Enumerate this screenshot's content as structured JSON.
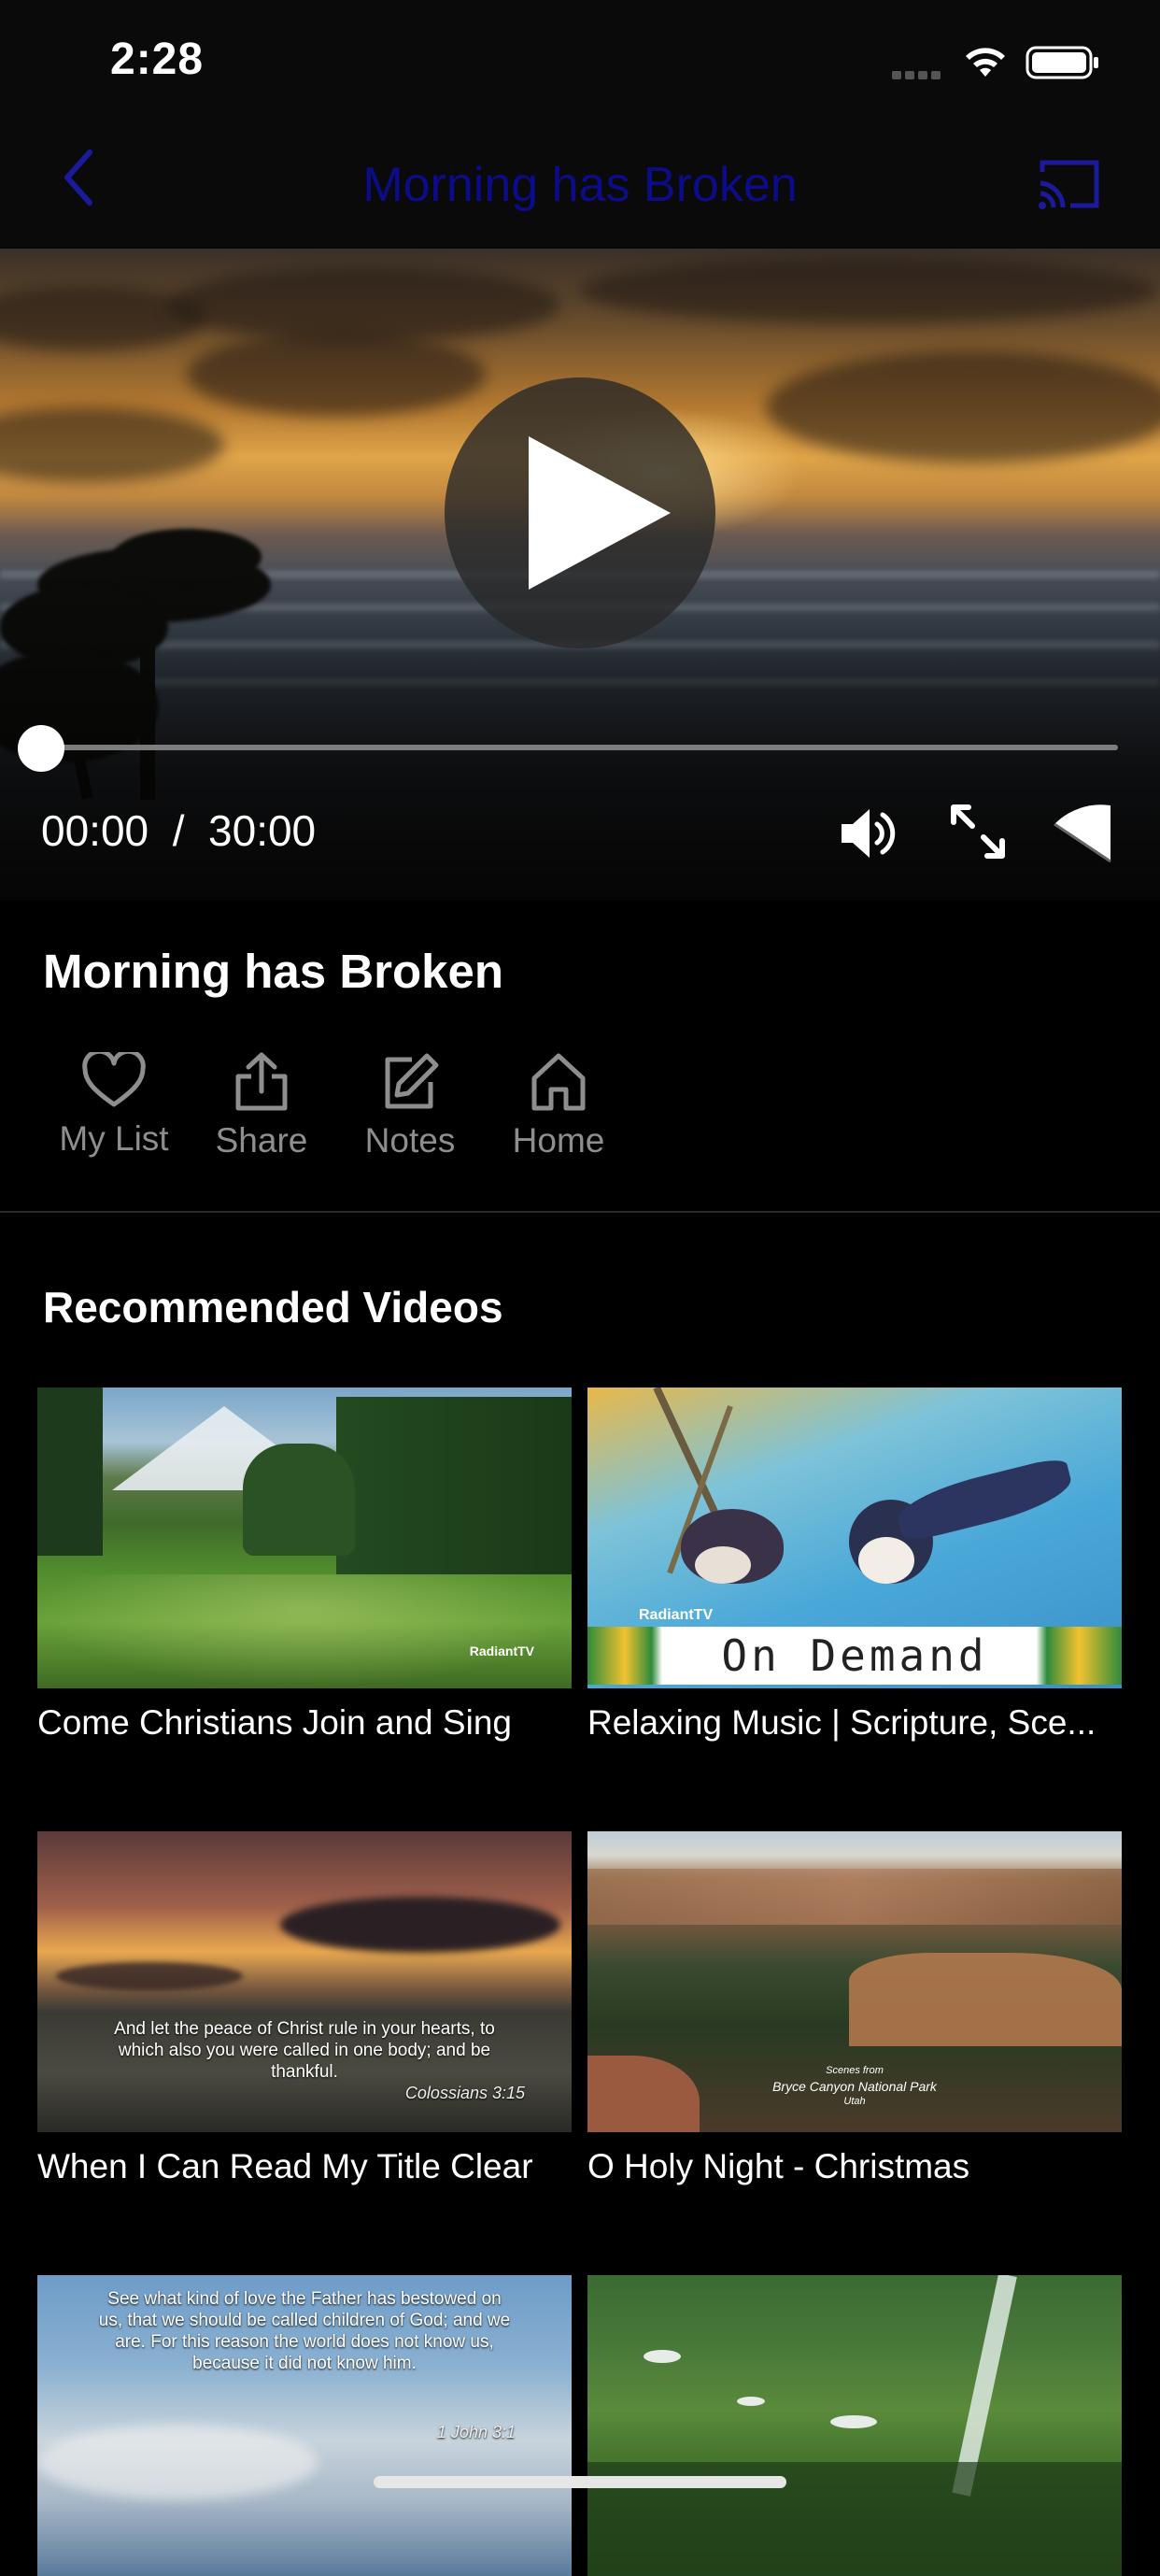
{
  "status_bar": {
    "time": "2:28"
  },
  "nav": {
    "title": "Morning has Broken"
  },
  "player": {
    "elapsed": "00:00",
    "separator": "/",
    "duration": "30:00",
    "progress_fraction": 0.0
  },
  "video": {
    "title": "Morning has Broken"
  },
  "actions": [
    {
      "label": "My List",
      "icon": "heart-icon"
    },
    {
      "label": "Share",
      "icon": "share-icon"
    },
    {
      "label": "Notes",
      "icon": "edit-icon"
    },
    {
      "label": "Home",
      "icon": "home-icon"
    }
  ],
  "recommended": {
    "title": "Recommended Videos",
    "items": [
      {
        "label": "Come Christians Join and Sing",
        "watermark": "RadiantTV"
      },
      {
        "label": "Relaxing Music | Scripture, Sce...",
        "watermark": "RadiantTV",
        "banner": "On Demand"
      },
      {
        "label": "When I Can Read My Title Clear",
        "verse": "And let the peace of Christ rule in your hearts, to which also you were called in one body; and be thankful.",
        "verse_ref": "Colossians 3:15"
      },
      {
        "label": "O Holy Night - Christmas",
        "caption_small": "Scenes from",
        "caption": "Bryce Canyon National Park",
        "caption_sub": "Utah"
      },
      {
        "label": "",
        "verse": "See what kind of love the Father has bestowed on us, that we should be called children of God; and we are. For this reason the world does not know us, because it did not know him.",
        "verse_ref": "1 John 3:1"
      },
      {
        "label": ""
      }
    ]
  },
  "colors": {
    "background": "#000000",
    "nav_title": "#0c0c8a",
    "nav_icon": "#1a1a9a",
    "muted_text": "#8e8e8e"
  }
}
